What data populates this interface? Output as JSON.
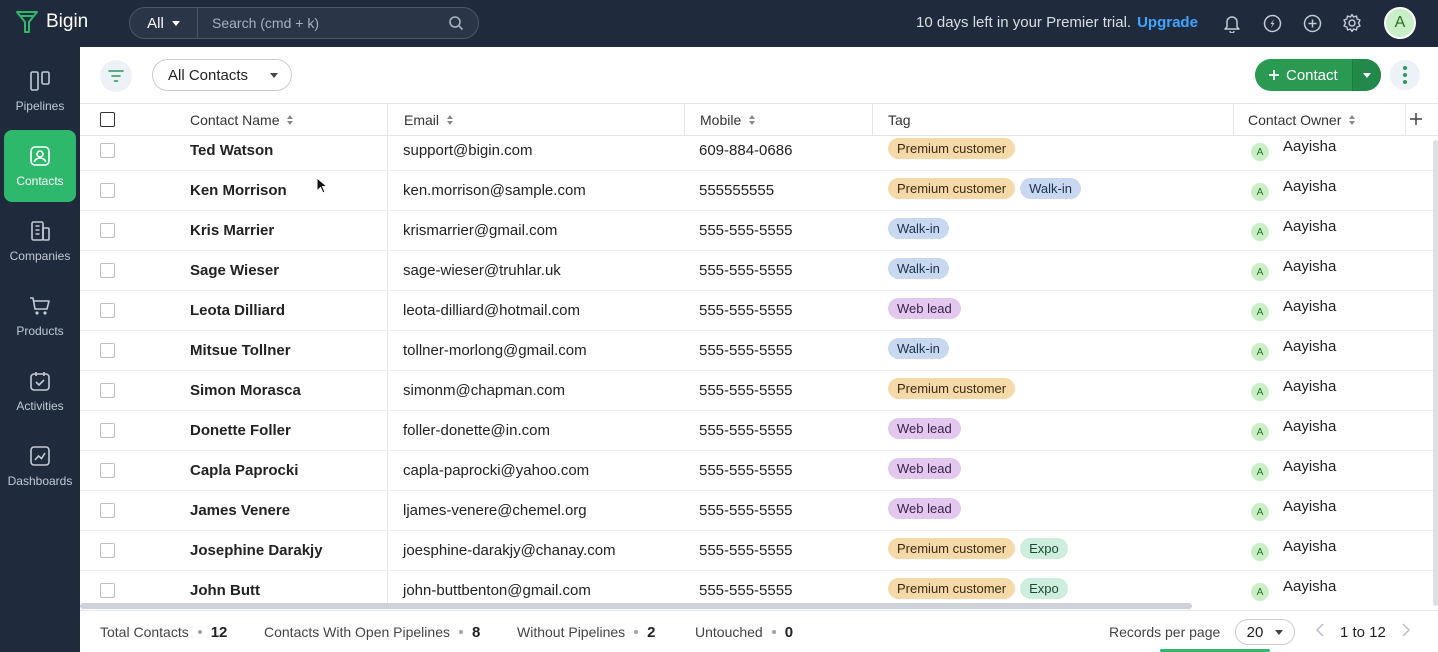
{
  "topbar": {
    "app_name": "Bigin",
    "search_scope": "All",
    "search_placeholder": "Search (cmd + k)",
    "trial_text": "10 days left in your Premier trial.",
    "upgrade_label": "Upgrade",
    "avatar_initial": "A"
  },
  "sidebar": {
    "items": [
      {
        "label": "Pipelines",
        "icon": "pipelines-icon"
      },
      {
        "label": "Contacts",
        "icon": "contacts-icon"
      },
      {
        "label": "Companies",
        "icon": "companies-icon"
      },
      {
        "label": "Products",
        "icon": "cart-icon"
      },
      {
        "label": "Activities",
        "icon": "calendar-check-icon"
      },
      {
        "label": "Dashboards",
        "icon": "chart-icon"
      }
    ],
    "active": "Contacts"
  },
  "toolbar": {
    "view_label": "All Contacts",
    "add_label": "Contact"
  },
  "table": {
    "columns": [
      "Contact Name",
      "Email",
      "Mobile",
      "Tag",
      "Contact Owner"
    ],
    "rows": [
      {
        "name": "Ted Watson",
        "email": "support@bigin.com",
        "mobile": "609-884-0686",
        "tags": [
          "Premium customer"
        ],
        "owner": "Aayisha",
        "owner_initial": "A"
      },
      {
        "name": "Ken Morrison",
        "email": "ken.morrison@sample.com",
        "mobile": "555555555",
        "tags": [
          "Premium customer",
          "Walk-in"
        ],
        "owner": "Aayisha",
        "owner_initial": "A"
      },
      {
        "name": "Kris Marrier",
        "email": "krismarrier@gmail.com",
        "mobile": "555-555-5555",
        "tags": [
          "Walk-in"
        ],
        "owner": "Aayisha",
        "owner_initial": "A"
      },
      {
        "name": "Sage Wieser",
        "email": "sage-wieser@truhlar.uk",
        "mobile": "555-555-5555",
        "tags": [
          "Walk-in"
        ],
        "owner": "Aayisha",
        "owner_initial": "A"
      },
      {
        "name": "Leota Dilliard",
        "email": "leota-dilliard@hotmail.com",
        "mobile": "555-555-5555",
        "tags": [
          "Web lead"
        ],
        "owner": "Aayisha",
        "owner_initial": "A"
      },
      {
        "name": "Mitsue Tollner",
        "email": "tollner-morlong@gmail.com",
        "mobile": "555-555-5555",
        "tags": [
          "Walk-in"
        ],
        "owner": "Aayisha",
        "owner_initial": "A"
      },
      {
        "name": "Simon Morasca",
        "email": "simonm@chapman.com",
        "mobile": "555-555-5555",
        "tags": [
          "Premium customer"
        ],
        "owner": "Aayisha",
        "owner_initial": "A"
      },
      {
        "name": "Donette Foller",
        "email": "foller-donette@in.com",
        "mobile": "555-555-5555",
        "tags": [
          "Web lead"
        ],
        "owner": "Aayisha",
        "owner_initial": "A"
      },
      {
        "name": "Capla Paprocki",
        "email": "capla-paprocki@yahoo.com",
        "mobile": "555-555-5555",
        "tags": [
          "Web lead"
        ],
        "owner": "Aayisha",
        "owner_initial": "A"
      },
      {
        "name": "James Venere",
        "email": "ljames-venere@chemel.org",
        "mobile": "555-555-5555",
        "tags": [
          "Web lead"
        ],
        "owner": "Aayisha",
        "owner_initial": "A"
      },
      {
        "name": "Josephine Darakjy",
        "email": "joesphine-darakjy@chanay.com",
        "mobile": "555-555-5555",
        "tags": [
          "Premium customer",
          "Expo"
        ],
        "owner": "Aayisha",
        "owner_initial": "A"
      },
      {
        "name": "John Butt",
        "email": "john-buttbenton@gmail.com",
        "mobile": "555-555-5555",
        "tags": [
          "Premium customer",
          "Expo"
        ],
        "owner": "Aayisha",
        "owner_initial": "A"
      }
    ]
  },
  "footer": {
    "total_label": "Total Contacts",
    "total_value": "12",
    "open_label": "Contacts With Open Pipelines",
    "open_value": "8",
    "without_label": "Without Pipelines",
    "without_value": "2",
    "untouched_label": "Untouched",
    "untouched_value": "0",
    "records_label": "Records per page",
    "records_value": "20",
    "range": "1 to 12"
  },
  "colors": {
    "nav_bg": "#1f2a3d",
    "active_green": "#2eb86b",
    "button_green": "#2a9a53",
    "link_blue": "#3ea6ff"
  }
}
